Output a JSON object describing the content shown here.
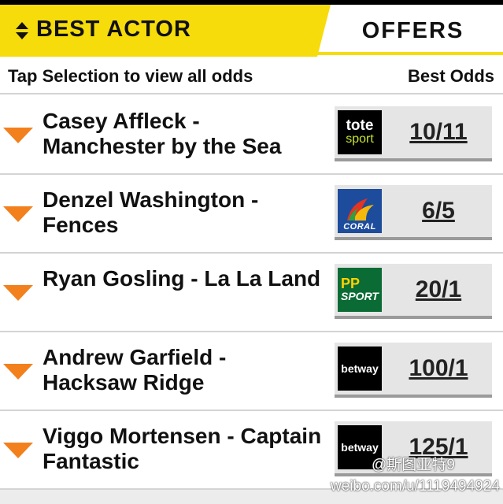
{
  "header": {
    "active_tab": "BEST ACTOR",
    "offers_tab": "OFFERS"
  },
  "subheader": {
    "left": "Tap Selection to view all odds",
    "right": "Best Odds"
  },
  "selections": [
    {
      "name": "Casey Affleck - Manchester by the Sea",
      "bookmaker": "tote sport",
      "logo_line1": "tote",
      "logo_line2": "sport",
      "odds": "10/11"
    },
    {
      "name": "Denzel Washington - Fences",
      "bookmaker": "Coral",
      "logo_text": "CORAL",
      "odds": "6/5"
    },
    {
      "name": "Ryan Gosling - La La Land",
      "bookmaker": "PP Sport",
      "logo_line1": "PP",
      "logo_line2": "SPORT",
      "odds": "20/1"
    },
    {
      "name": "Andrew Garfield - Hacksaw Ridge",
      "bookmaker": "betway",
      "logo_text": "betway",
      "odds": "100/1"
    },
    {
      "name": "Viggo Mortensen - Captain Fantastic",
      "bookmaker": "betway",
      "logo_text": "betway",
      "odds": "125/1"
    }
  ],
  "watermark": {
    "handle": "@斯图亚特9",
    "url": "weibo.com/u/1119494924"
  },
  "icons": {
    "sort": "sort-arrows-icon",
    "expand": "expand-triangle-icon"
  },
  "colors": {
    "accent_yellow": "#f6dc0b",
    "expand_orange": "#f2801d",
    "odds_box": "#e5e5e5"
  }
}
